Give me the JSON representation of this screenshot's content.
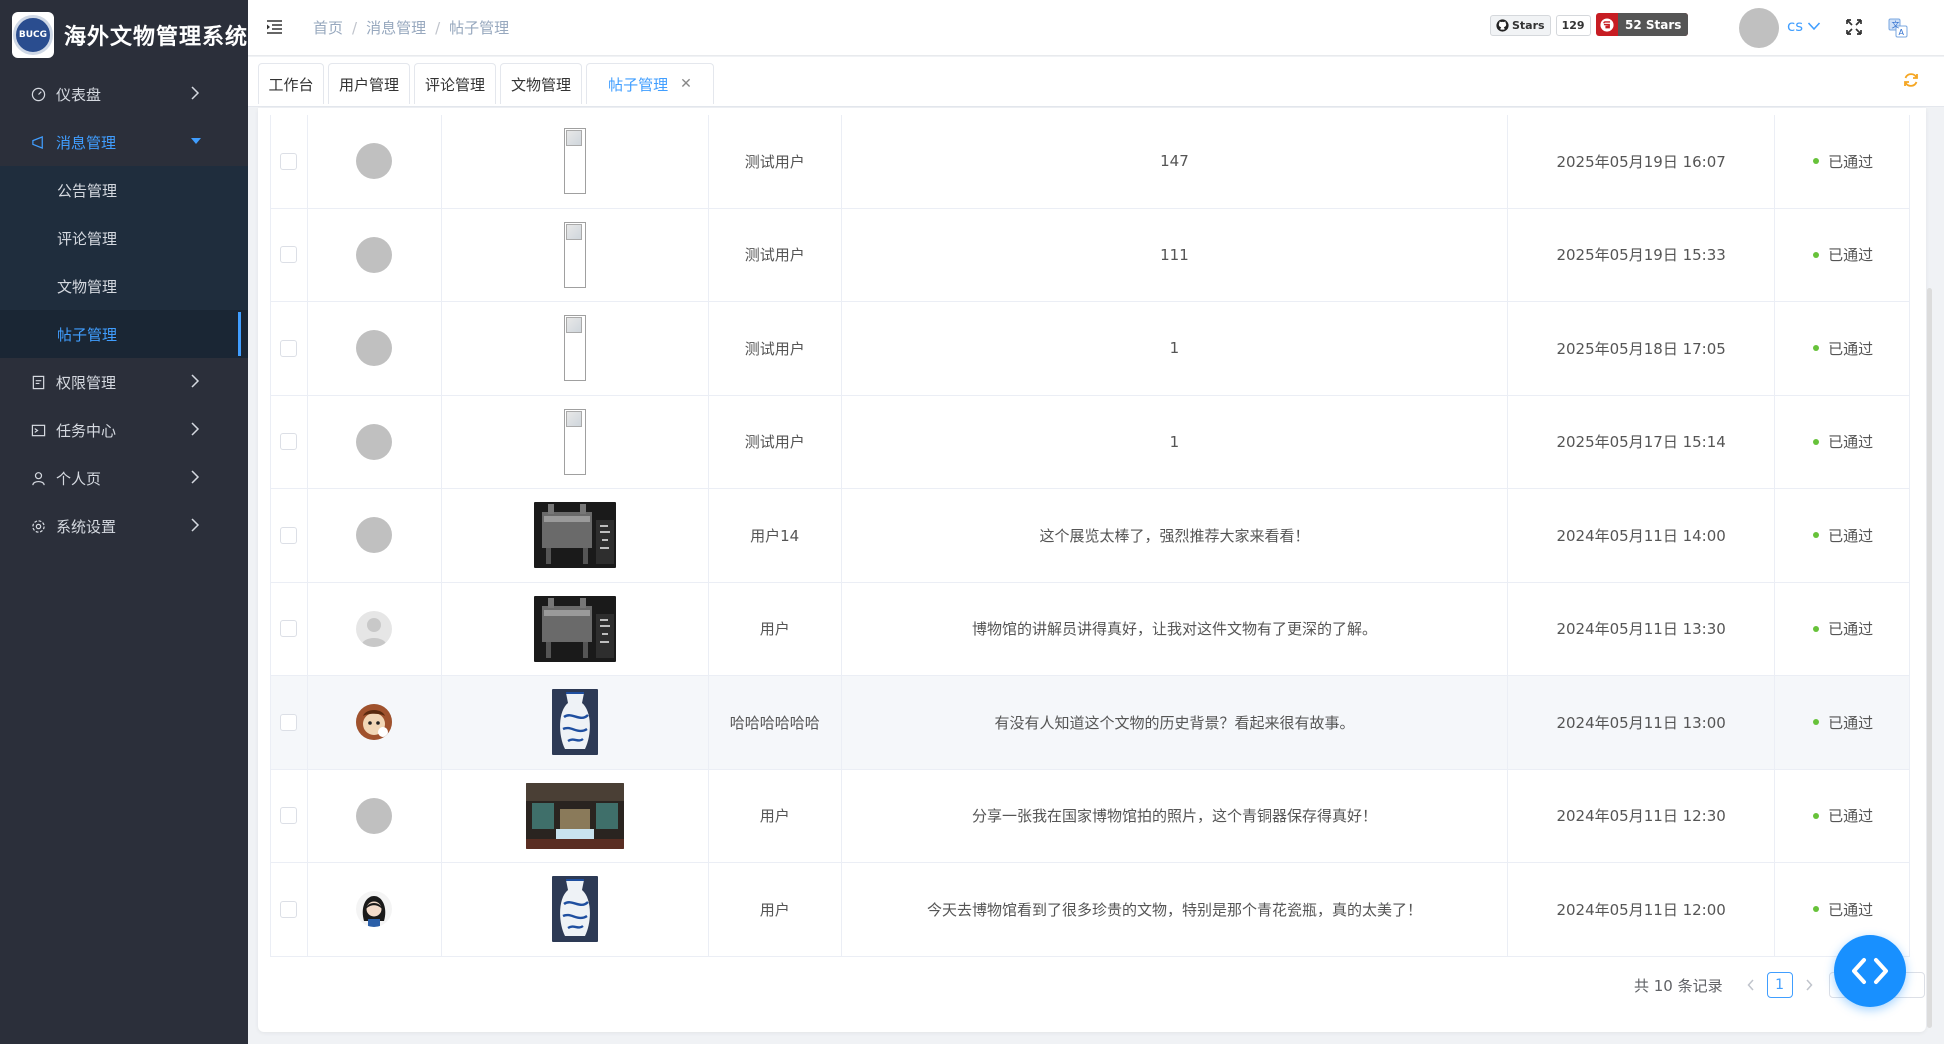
{
  "app": {
    "title": "海外文物管理系统",
    "logo_text": "BUCG"
  },
  "sidebar": {
    "items": [
      {
        "label": "仪表盘",
        "icon": "dashboard-icon"
      },
      {
        "label": "消息管理",
        "icon": "message-icon",
        "expanded": true
      },
      {
        "label": "权限管理",
        "icon": "permission-icon"
      },
      {
        "label": "任务中心",
        "icon": "task-icon"
      },
      {
        "label": "个人页",
        "icon": "user-icon"
      },
      {
        "label": "系统设置",
        "icon": "settings-icon"
      }
    ],
    "submenu": [
      {
        "label": "公告管理"
      },
      {
        "label": "评论管理"
      },
      {
        "label": "文物管理"
      },
      {
        "label": "帖子管理",
        "active": true
      }
    ]
  },
  "header": {
    "breadcrumb": [
      "首页",
      "消息管理",
      "帖子管理"
    ],
    "github_label": "Stars",
    "github_count": "129",
    "gitee_label": "52 Stars",
    "user_name": "cs"
  },
  "tabs": [
    {
      "label": "工作台"
    },
    {
      "label": "用户管理"
    },
    {
      "label": "评论管理"
    },
    {
      "label": "文物管理"
    },
    {
      "label": "帖子管理",
      "active": true
    }
  ],
  "table": {
    "rows": [
      {
        "user": "测试用户",
        "content": "147",
        "time": "2025年05月19日 16:07",
        "status": "已通过",
        "image": "broken",
        "avatar": "gray"
      },
      {
        "user": "测试用户",
        "content": "111",
        "time": "2025年05月19日 15:33",
        "status": "已通过",
        "image": "broken",
        "avatar": "gray"
      },
      {
        "user": "测试用户",
        "content": "1",
        "time": "2025年05月18日 17:05",
        "status": "已通过",
        "image": "broken",
        "avatar": "gray"
      },
      {
        "user": "测试用户",
        "content": "1",
        "time": "2025年05月17日 15:14",
        "status": "已通过",
        "image": "broken",
        "avatar": "gray"
      },
      {
        "user": "用户14",
        "content": "这个展览太棒了，强烈推荐大家来看看！",
        "time": "2024年05月11日 14:00",
        "status": "已通过",
        "image": "bronze",
        "avatar": "gray"
      },
      {
        "user": "用户",
        "content": "博物馆的讲解员讲得真好，让我对这件文物有了更深的了解。",
        "time": "2024年05月11日 13:30",
        "status": "已通过",
        "image": "bronze",
        "avatar": "silhouette"
      },
      {
        "user": "哈哈哈哈哈哈",
        "content": "有没有人知道这个文物的历史背景？看起来很有故事。",
        "time": "2024年05月11日 13:00",
        "status": "已通过",
        "image": "vase",
        "avatar": "cartoon"
      },
      {
        "user": "用户",
        "content": "分享一张我在国家博物馆拍的照片，这个青铜器保存得真好！",
        "time": "2024年05月11日 12:30",
        "status": "已通过",
        "image": "museum",
        "avatar": "gray"
      },
      {
        "user": "用户",
        "content": "今天去博物馆看到了很多珍贵的文物，特别是那个青花瓷瓶，真的太美了！",
        "time": "2024年05月11日 12:00",
        "status": "已通过",
        "image": "vase",
        "avatar": "girl"
      }
    ]
  },
  "pagination": {
    "total_text": "共 10 条记录",
    "current": "1",
    "page_size": "10"
  },
  "colors": {
    "primary": "#409eff",
    "sidebar_bg": "#2b2f3a",
    "submenu_bg": "#1f2d3d",
    "success": "#67c23a",
    "gitee": "#c71d23"
  }
}
